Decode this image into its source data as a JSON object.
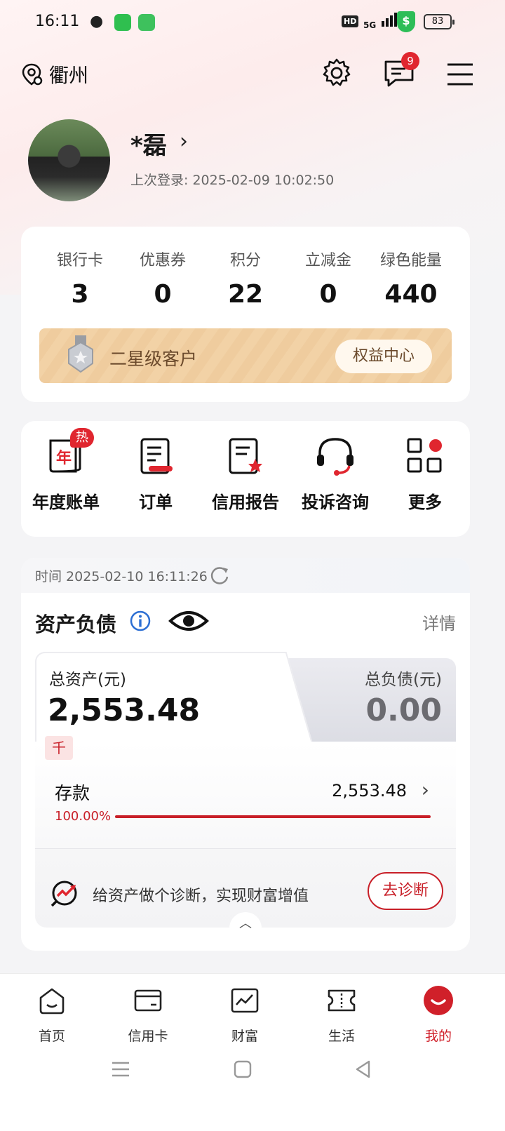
{
  "status_bar": {
    "time": "16:11",
    "network": "5G",
    "hd": "HD",
    "battery": "83",
    "shield": "$"
  },
  "header": {
    "city": "衢州",
    "notification_count": "9"
  },
  "profile": {
    "name": "*磊",
    "chevron": "›",
    "last_login": "上次登录: 2025-02-09 10:02:50"
  },
  "stats": [
    {
      "label": "银行卡",
      "value": "3"
    },
    {
      "label": "优惠券",
      "value": "0"
    },
    {
      "label": "积分",
      "value": "22"
    },
    {
      "label": "立减金",
      "value": "0"
    },
    {
      "label": "绿色能量",
      "value": "440"
    }
  ],
  "level": {
    "text": "二星级客户",
    "button": "权益中心"
  },
  "functions": [
    {
      "label": "年度账单",
      "badge": "热",
      "icon": "annual-bill-icon",
      "icon_char": "年"
    },
    {
      "label": "订单",
      "icon": "order-icon"
    },
    {
      "label": "信用报告",
      "icon": "credit-report-icon"
    },
    {
      "label": "投诉咨询",
      "icon": "headset-icon"
    },
    {
      "label": "更多",
      "icon": "more-grid-icon"
    }
  ],
  "assets": {
    "time": "时间 2025-02-10 16:11:26",
    "title": "资产负债",
    "detail": "详情",
    "total_assets_label": "总资产(元)",
    "total_assets_value": "2,553.48",
    "unit_tag": "千",
    "total_debt_label": "总负债(元)",
    "total_debt_value": "0.00",
    "deposit_label": "存款",
    "deposit_value": "2,553.48",
    "deposit_percent": "100.00%",
    "deposit_fraction": 1.0,
    "diagnosis_text": "给资产做个诊断，实现财富增值",
    "diagnosis_button": "去诊断"
  },
  "tabs": [
    {
      "label": "首页",
      "icon": "home-icon",
      "active": false
    },
    {
      "label": "信用卡",
      "icon": "credit-card-icon",
      "active": false
    },
    {
      "label": "财富",
      "icon": "wealth-chart-icon",
      "active": false
    },
    {
      "label": "生活",
      "icon": "life-ticket-icon",
      "active": false
    },
    {
      "label": "我的",
      "icon": "my-profile-icon",
      "active": true
    }
  ],
  "colors": {
    "brand_red": "#d0202a",
    "gold_bar": "#f2d2a6",
    "text_gold": "#6b4a2c"
  }
}
